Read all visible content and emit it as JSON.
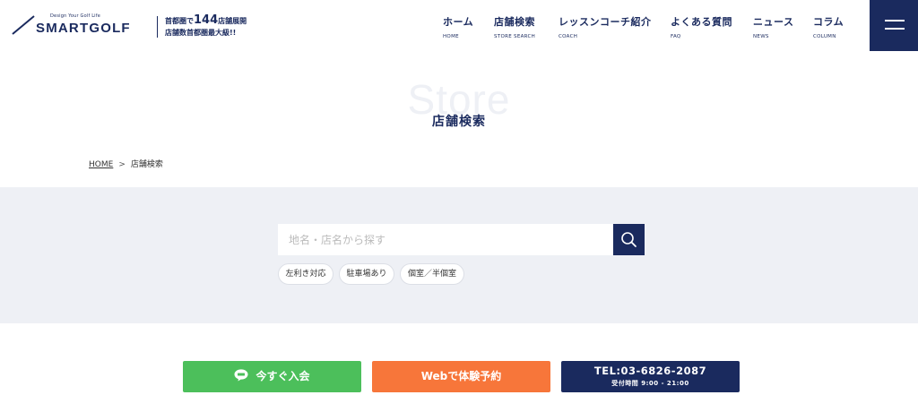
{
  "header": {
    "logo": {
      "tagline": "Design Your Golf Life",
      "brand": "SMARTGOLF"
    },
    "promo": {
      "line1_prefix": "首都圏で",
      "line1_number": "144",
      "line1_suffix": "店舗展開",
      "line2": "店舗数首都圏最大級!!"
    },
    "nav": [
      {
        "label": "ホーム",
        "sub": "HOME"
      },
      {
        "label": "店舗検索",
        "sub": "STORE SEARCH"
      },
      {
        "label": "レッスンコーチ紹介",
        "sub": "COACH"
      },
      {
        "label": "よくある質問",
        "sub": "FAQ"
      },
      {
        "label": "ニュース",
        "sub": "NEWS"
      },
      {
        "label": "コラム",
        "sub": "COLUMN"
      }
    ],
    "menu_icon": "hamburger-icon"
  },
  "hero": {
    "bg_word": "Store",
    "title": "店舗検索"
  },
  "breadcrumb": {
    "home": "HOME",
    "separator": ">",
    "current": "店舗検索"
  },
  "search": {
    "placeholder": "地名・店名から探す",
    "value": "",
    "button_icon": "search-icon",
    "filters": [
      "左利き対応",
      "駐車場あり",
      "個室／半個室"
    ]
  },
  "cta": {
    "join": {
      "label": "今すぐ入会",
      "icon": "line-icon",
      "color": "#4cbf5b"
    },
    "trial": {
      "label": "Webで体験予約",
      "color": "#f7763a"
    },
    "tel": {
      "label": "TEL:03-6826-2087",
      "hours": "受付時間 9:00 - 21:00",
      "color": "#1a2a5e"
    }
  },
  "colors": {
    "navy": "#1a2a5e",
    "search_bg": "#eef0f5"
  }
}
